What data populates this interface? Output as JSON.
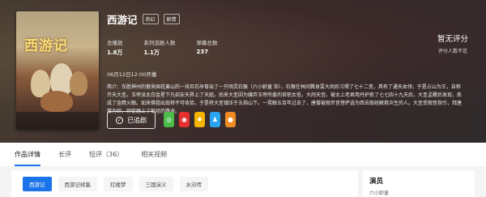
{
  "poster": {
    "title": "西游记",
    "caption": ""
  },
  "header": {
    "title": "西游记",
    "tags": [
      "奇幻",
      "剧情"
    ]
  },
  "stats": [
    {
      "label": "总播放",
      "value": "1.8万"
    },
    {
      "label": "系列追剧人数",
      "value": "1.1万"
    },
    {
      "label": "弹幕总数",
      "value": "237"
    }
  ],
  "date": "06月12日12:00开播",
  "description": "简介：东胜神州的傲来国花果山的一块巨石孕育出了一只明灵石猴（六小龄童 饰），石猴在林间腾身耍大闹后习得了七十二变，具有了通天本领，于是占山为王，自称齐天大圣。玉帝派太白金星下凡招安天界上了天庭。后来大圣因为嫌弃玉帝所委的官职太低，大闹天宫。被太上老君用丹炉炼了七七四十九天后，大圣孟醒后发现，炼成了金睛火眼。如来佛祖出现将不可收拾，于是将大圣镇压于五指山下。一晃眼五百年过去了，唐僧被观世音菩萨选为西去取经解救众生的人。大圣受观音指引，拜唐僧为师，师徒踏上了取经的路途。",
  "score": {
    "main": "暂无评分",
    "sub": "评分人数不足"
  },
  "follow": {
    "label": "已追剧"
  },
  "share": [
    {
      "icon": "wechat-icon",
      "color": "#4bbb4a",
      "glyph": "◎"
    },
    {
      "icon": "weibo-icon",
      "color": "#e6302f",
      "glyph": "◉"
    },
    {
      "icon": "qzone-icon",
      "color": "#f5b400",
      "glyph": "✸"
    },
    {
      "icon": "qq-icon",
      "color": "#2aa6f0",
      "glyph": "♟"
    },
    {
      "icon": "more-icon",
      "color": "#f08a24",
      "glyph": "●"
    }
  ],
  "tabs": [
    {
      "label": "作品详情",
      "active": true
    },
    {
      "label": "长评",
      "active": false
    },
    {
      "label": "短评（36）",
      "active": false
    },
    {
      "label": "相关视频",
      "active": false
    }
  ],
  "pills": [
    {
      "label": "西游记",
      "active": true
    },
    {
      "label": "西游记续集",
      "active": false
    },
    {
      "label": "红楼梦",
      "active": false
    },
    {
      "label": "三国演义",
      "active": false
    },
    {
      "label": "水浒传",
      "active": false
    }
  ],
  "side": {
    "heading": "演员",
    "name": "六小龄童"
  }
}
